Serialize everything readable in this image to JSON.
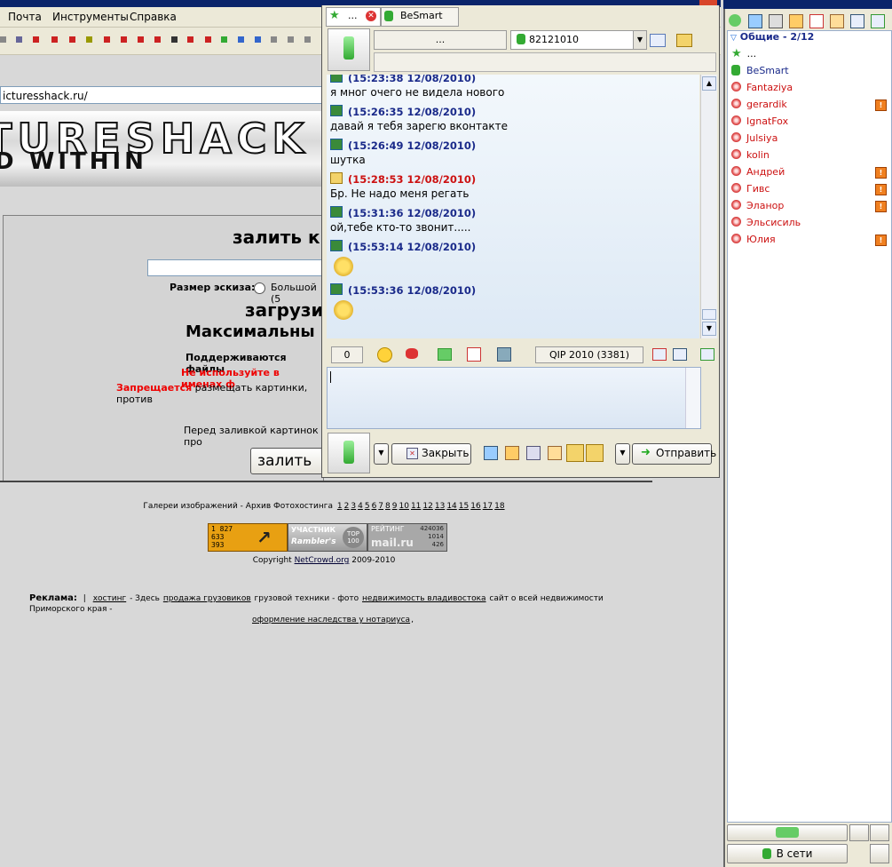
{
  "browser": {
    "menu": [
      "Почта",
      "Инструменты",
      "Справка"
    ],
    "address": "icturesshack.ru/",
    "banner_top": "TURESHACK",
    "banner_bottom": "D WITHIN",
    "panel": {
      "title": "залить к",
      "thumb_label": "Размер эскиза:",
      "thumb_option": "Большой (5",
      "upload_heading": "загрузи",
      "max_heading": "Максимальны",
      "supported": "Поддерживаются файлы",
      "no_use": "Не используйте в именах ф",
      "forbidden_bold": "Запрещается",
      "forbidden_rest": " размещать картинки, против",
      "before": "Перед заливкой картинок про",
      "upload_button": "залить"
    },
    "footer": {
      "gallery_prefix": "Галереи изображений - Архив Фотохостинга",
      "pages": [
        "1",
        "2",
        "3",
        "4",
        "5",
        "6",
        "7",
        "8",
        "9",
        "10",
        "11",
        "12",
        "13",
        "14",
        "15",
        "16",
        "17",
        "18"
      ],
      "counter1": [
        "1 827",
        "633",
        "393"
      ],
      "counter2_a": "УЧАСТНИК",
      "counter2_b": "Rambler's",
      "counter2_c": "TOP 100",
      "counter3_a": "РЕЙТИНГ",
      "counter3_b": "mail.ru",
      "counter3_vals": [
        "424036",
        "1014",
        "426"
      ],
      "copyright_prefix": "Copyright",
      "copyright_link": "NetCrowd.org",
      "copyright_suffix": "2009-2010",
      "ads_label": "Реклама:",
      "ads_sep": "|",
      "ads_link1": "хостинг",
      "ads_text1": "- Здесь",
      "ads_link2": "продажа грузовиков",
      "ads_text2": "грузовой техники - фото",
      "ads_link3": "недвижимость владивостока",
      "ads_text3": "сайт о всей недвижимости Приморского края -",
      "ads_link4": "оформление наследства у нотариуса",
      "ads_text4": ","
    }
  },
  "chat": {
    "tab1": "...",
    "tab2": "BeSmart",
    "nick": "...",
    "uin": "82121010",
    "messages": [
      {
        "stamp": "(15:23:38 12/08/2010)",
        "color": "#1a2a8a",
        "text": "я мног очего не видела нового"
      },
      {
        "stamp": "(15:26:35 12/08/2010)",
        "color": "#1a2a8a",
        "text": "давай я тебя зарегю вконтакте"
      },
      {
        "stamp": "(15:26:49 12/08/2010)",
        "color": "#1a2a8a",
        "text": "шутка"
      },
      {
        "stamp": "(15:28:53 12/08/2010)",
        "color": "#cc1111",
        "text": "Бр. Не надо меня регать"
      },
      {
        "stamp": "(15:31:36 12/08/2010)",
        "color": "#1a2a8a",
        "text": "ой,тебе кто-то звонит....."
      },
      {
        "stamp": "(15:53:14 12/08/2010)",
        "color": "#1a2a8a",
        "text": ""
      },
      {
        "stamp": "(15:53:36 12/08/2010)",
        "color": "#1a2a8a",
        "text": ""
      }
    ],
    "counter": "0",
    "client_version": "QIP 2010 (3381)",
    "close_button": "Закрыть",
    "send_button": "Отправить"
  },
  "contacts": {
    "group": "Общие - 2/12",
    "items": [
      {
        "name": "...",
        "color": "#000000",
        "status": "star",
        "warn": false
      },
      {
        "name": "BeSmart",
        "color": "#1a2a8a",
        "status": "online",
        "warn": false
      },
      {
        "name": "Fantaziya",
        "color": "#cc1111",
        "status": "offline",
        "warn": false
      },
      {
        "name": "gerardik",
        "color": "#cc1111",
        "status": "offline",
        "warn": true
      },
      {
        "name": "IgnatFox",
        "color": "#cc1111",
        "status": "offline",
        "warn": false
      },
      {
        "name": "Julsiya",
        "color": "#cc1111",
        "status": "offline",
        "warn": false
      },
      {
        "name": "kolin",
        "color": "#cc1111",
        "status": "offline",
        "warn": false
      },
      {
        "name": "Андрей",
        "color": "#cc1111",
        "status": "offline",
        "warn": true
      },
      {
        "name": "Гивс",
        "color": "#cc1111",
        "status": "offline",
        "warn": true
      },
      {
        "name": "Эланор",
        "color": "#cc1111",
        "status": "offline",
        "warn": true
      },
      {
        "name": "Эльсисиль",
        "color": "#cc1111",
        "status": "offline",
        "warn": false
      },
      {
        "name": "Юлия",
        "color": "#cc1111",
        "status": "offline",
        "warn": true
      }
    ],
    "status_button": "В сети"
  }
}
